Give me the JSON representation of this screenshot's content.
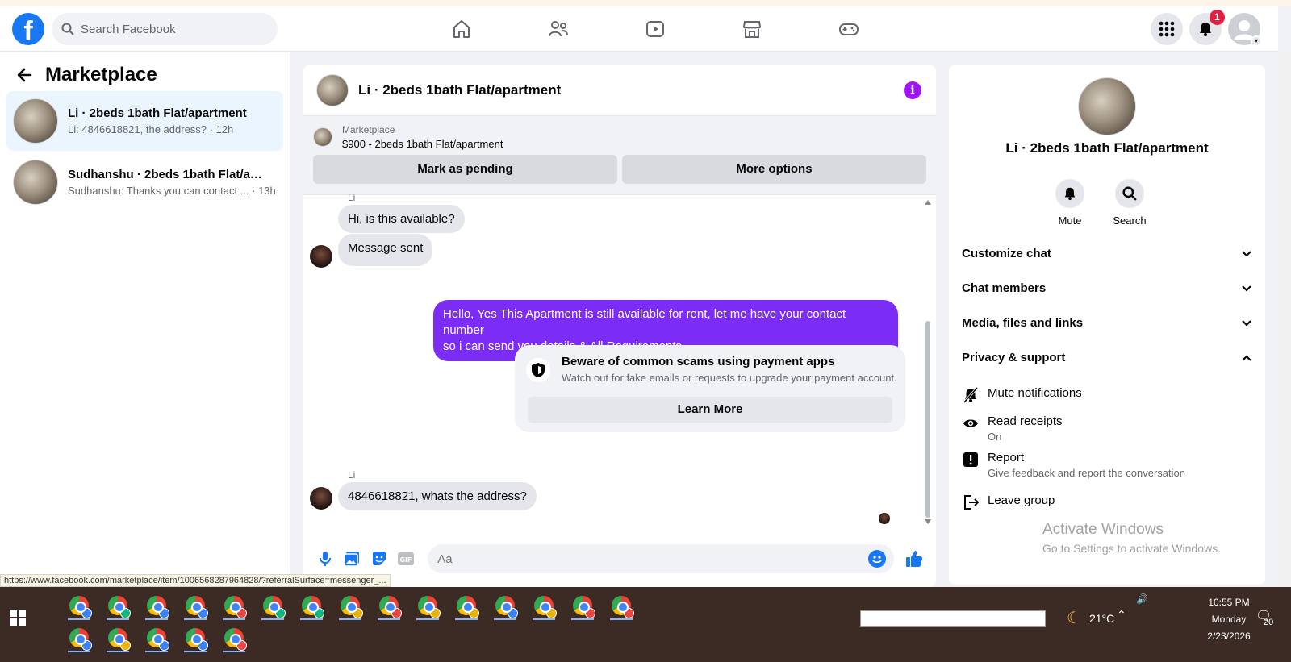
{
  "topnav": {
    "search_placeholder": "Search Facebook",
    "notification_count": "1",
    "logo_letter": "f"
  },
  "sidebar": {
    "title": "Marketplace",
    "conversations": [
      {
        "name": "Li · 2beds 1bath Flat/apartment",
        "preview": "Li: 4846618821, the address? · 12h"
      },
      {
        "name": "Sudhanshu · 2beds 1bath Flat/apar...",
        "preview": "Sudhanshu: Thanks you can contact ... · 13h"
      }
    ]
  },
  "chat": {
    "title": "Li · 2beds 1bath Flat/apartment",
    "listing": {
      "source": "Marketplace",
      "price_title": "$900 - 2beds 1bath Flat/apartment",
      "buttons": [
        "Mark as pending",
        "More options"
      ]
    },
    "messages": {
      "sender_label_top": "Li",
      "msg1": "Hi, is this available?",
      "msg2": "Message sent",
      "msg3_line1": "Hello, Yes This Apartment is still available for rent, let me have your contact number",
      "msg3_line2": "so i can send you details & All Requirements.",
      "scam_title": "Beware of common scams using payment apps",
      "scam_sub": "Watch out for fake emails or requests to upgrade your payment account.",
      "scam_button": "Learn More",
      "sender_label_bottom": "Li",
      "msg4": "4846618821, whats the address?"
    },
    "composer_placeholder": "Aa"
  },
  "right_panel": {
    "title": "Li · 2beds 1bath Flat/apartment",
    "actions": [
      "Mute",
      "Search"
    ],
    "sections": [
      "Customize chat",
      "Chat members",
      "Media, files and links",
      "Privacy & support"
    ],
    "items": [
      {
        "label": "Mute notifications",
        "sub": ""
      },
      {
        "label": "Read receipts",
        "sub": "On"
      },
      {
        "label": "Report",
        "sub": "Give feedback and report the conversation"
      },
      {
        "label": "Leave group",
        "sub": ""
      }
    ],
    "watermark_title": "Activate Windows",
    "watermark_sub": "Go to Settings to activate Windows."
  },
  "status_url": "https://www.facebook.com/marketplace/item/1006568287964828/?referralSurface=messenger_...",
  "taskbar": {
    "weather_temp": "21°C",
    "time": "10:55 PM",
    "day": "Monday",
    "date": "2/23/2026",
    "notif_count": "20",
    "chrome_profile_colors": [
      "#3b82f6",
      "#10b981",
      "#3b82f6",
      "#3b82f6",
      "#ef4444",
      "#10b981",
      "#10b981",
      "#eab308",
      "#ef4444",
      "#eab308",
      "#eab308",
      "#3b82f6",
      "#eab308",
      "#ef4444",
      "#ef4444",
      "#3b82f6",
      "#eab308",
      "#3b82f6",
      "#3b82f6",
      "#ef4444"
    ]
  },
  "colors": {
    "brand": "#1877f2",
    "my_bubble": "#7b2cf5",
    "info": "#a112f5"
  }
}
